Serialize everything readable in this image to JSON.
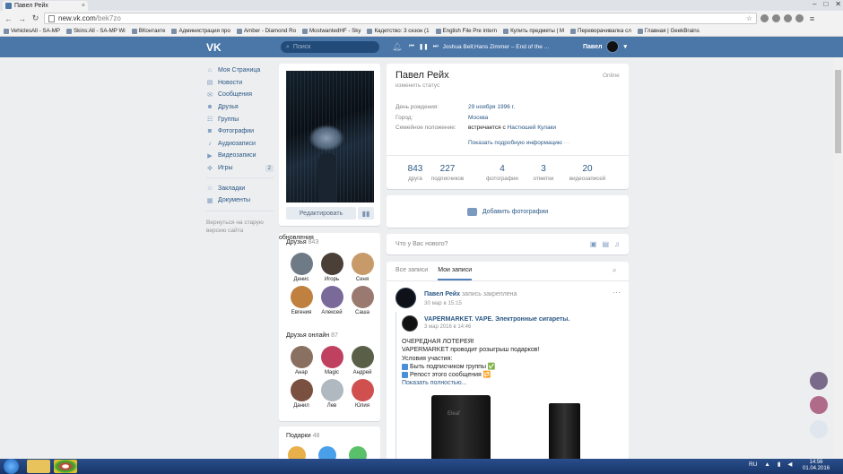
{
  "browser": {
    "tab_title": "Павел Рейх",
    "url_host": "new.vk.com",
    "url_path": "/bek7zo",
    "bookmarks": [
      "VehiclesAll - SA-MP",
      "Skins:All - SA-MP Wi",
      "ВКонтакте",
      "Администрация про",
      "Amber - Diamond Ro",
      "MostwantedHF - Sky",
      "Кадетство: 3 сезон (1",
      "English File Pre intern",
      "Купить предметы | M",
      "Переворачивалка сл",
      "Главная | GeekBrains"
    ]
  },
  "header": {
    "logo": "VK",
    "search_placeholder": "Поиск",
    "player_track": "Joshua Bell;Hans Zimmer – End of the ...",
    "user_name": "Павел"
  },
  "menu": {
    "items": [
      {
        "label": "Моя Страница",
        "icon": "home-icon"
      },
      {
        "label": "Новости",
        "icon": "news-icon"
      },
      {
        "label": "Сообщения",
        "icon": "messages-icon"
      },
      {
        "label": "Друзья",
        "icon": "friends-icon"
      },
      {
        "label": "Группы",
        "icon": "groups-icon"
      },
      {
        "label": "Фотографии",
        "icon": "camera-icon"
      },
      {
        "label": "Аудиозаписи",
        "icon": "music-icon"
      },
      {
        "label": "Видеозаписи",
        "icon": "video-icon"
      },
      {
        "label": "Игры",
        "icon": "games-icon",
        "badge": "2"
      }
    ],
    "extra": [
      {
        "label": "Закладки"
      },
      {
        "label": "Документы"
      }
    ],
    "old_version": "Вернуться на старую версию сайта"
  },
  "photo": {
    "edit_label": "Редактировать"
  },
  "friends": {
    "title": "Друзья",
    "count": "843",
    "more": "обновления",
    "items": [
      "Денис",
      "Игорь",
      "Сеня",
      "Евгения",
      "Алексей",
      "Саша"
    ]
  },
  "online": {
    "title": "Друзья онлайн",
    "count": "87",
    "items": [
      "Анар",
      "Magic",
      "Андрей",
      "Данил",
      "Лев",
      "Юлия"
    ]
  },
  "gifts": {
    "title": "Подарки",
    "count": "48"
  },
  "profile": {
    "name": "Павел Рейх",
    "status": "изменить статус",
    "online": "Online",
    "rows": [
      {
        "k": "День рождения:",
        "v": "29 ноября 1996 г."
      },
      {
        "k": "Город:",
        "v": "Москва"
      },
      {
        "k": "Семейное положение:",
        "v_pre": "встречается с",
        "v": "Настюшей Кулаки"
      }
    ],
    "more_info": "Показать подробную информацию",
    "stats": [
      {
        "n": "843",
        "l": "друга"
      },
      {
        "n": "227",
        "l": "подписчиков"
      },
      {
        "n": "4",
        "l": "фотографии"
      },
      {
        "n": "3",
        "l": "отметки"
      },
      {
        "n": "20",
        "l": "видеозаписей"
      }
    ]
  },
  "add_photo": "Добавить фотографии",
  "composer_placeholder": "Что у Вас нового?",
  "wall": {
    "tab_all": "Все записи",
    "tab_mine": "Мои записи",
    "post": {
      "author": "Павел Рейх",
      "pinned": "запись закреплена",
      "date": "30 мар в 15:15",
      "repost_name": "VAPERMARKET. VAPE. Электронные сигареты.",
      "repost_date": "3 мар 2016 в 14:46",
      "lines": [
        "ОЧЕРЕДНАЯ ЛОТЕРЕЯ!",
        "VAPERMARKET проводит розыгрыш подарков!",
        "Условия участия:",
        "Быть подписчиком группы ✅",
        "Репост этого сообщения 🔁"
      ],
      "show_more": "Показать полностью...",
      "product_logo": "Eleaf"
    }
  },
  "taskbar": {
    "lang": "RU",
    "time": "14:56",
    "date": "01.04.2016"
  }
}
